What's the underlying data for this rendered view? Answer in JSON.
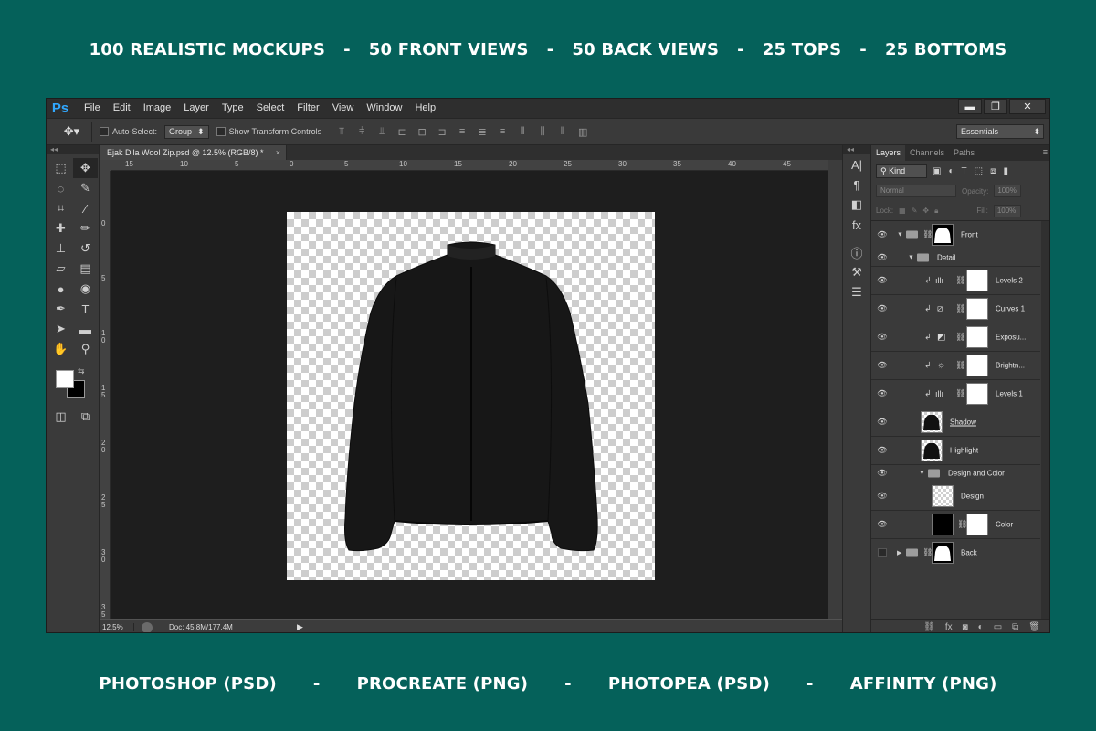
{
  "banner_top": [
    "100 REALISTIC MOCKUPS",
    "50 FRONT VIEWS",
    "50 BACK VIEWS",
    "25 TOPS",
    "25 BOTTOMS"
  ],
  "banner_bottom": [
    "PHOTOSHOP (PSD)",
    "PROCREATE (PNG)",
    "PHOTOPEA (PSD)",
    "AFFINITY (PNG)"
  ],
  "banner_separator": "-",
  "app": {
    "logo": "Ps",
    "menu": [
      "File",
      "Edit",
      "Image",
      "Layer",
      "Type",
      "Select",
      "Filter",
      "View",
      "Window",
      "Help"
    ],
    "window_controls": {
      "minimize": "▬",
      "restore": "❐",
      "close": "✕"
    }
  },
  "options": {
    "auto_select_label": "Auto-Select:",
    "auto_select_value": "Group",
    "show_transform_label": "Show Transform Controls",
    "workspace": "Essentials"
  },
  "document": {
    "tab_title": "Ejak Dila Wool Zip.psd @ 12.5% (RGB/8) *",
    "close": "×"
  },
  "ruler_top_labels": [
    "15",
    "10",
    "5",
    "0",
    "5",
    "10",
    "15",
    "20",
    "25",
    "30",
    "35",
    "40",
    "45"
  ],
  "ruler_left_labels": [
    "0",
    "5",
    "1 0",
    "1 5",
    "2 0",
    "2 5",
    "3 0",
    "3 5"
  ],
  "status": {
    "zoom": "12.5%",
    "doc_info": "Doc: 45.8M/177.4M",
    "arrow": "▶"
  },
  "layers_panel": {
    "tabs": [
      "Layers",
      "Channels",
      "Paths"
    ],
    "kind_label": "Kind",
    "blend_mode": "Normal",
    "opacity_label": "Opacity:",
    "opacity_value": "100%",
    "lock_label": "Lock:",
    "fill_label": "Fill:",
    "fill_value": "100%",
    "layers": [
      {
        "name": "Front"
      },
      {
        "name": "Detail"
      },
      {
        "name": "Levels 2"
      },
      {
        "name": "Curves 1"
      },
      {
        "name": "Exposu..."
      },
      {
        "name": "Brightn..."
      },
      {
        "name": "Levels 1"
      },
      {
        "name": "Shadow"
      },
      {
        "name": "Highlight"
      },
      {
        "name": "Design and Color"
      },
      {
        "name": "Design"
      },
      {
        "name": "Color"
      },
      {
        "name": "Back"
      }
    ]
  },
  "colors": {
    "background": "#05615a",
    "ps_blue": "#31a8ff",
    "panel": "#3a3a3a",
    "canvas": "#1e1e1e"
  }
}
